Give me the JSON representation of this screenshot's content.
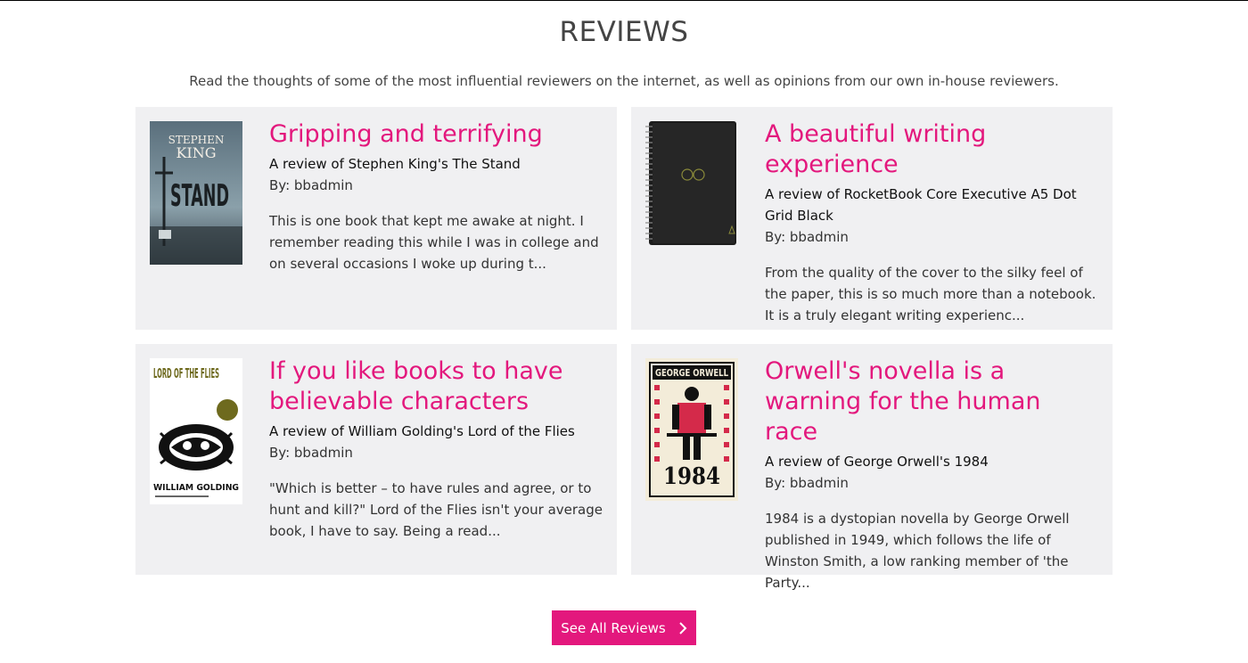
{
  "section": {
    "title": "REVIEWS",
    "subtitle": "Read the thoughts of some of the most influential reviewers on the internet, as well as opinions from our own in-house reviewers."
  },
  "reviews": [
    {
      "title": "Gripping and terrifying",
      "subject": "A review of Stephen King's The Stand",
      "author": "By: bbadmin",
      "excerpt": "This is one book that kept me awake at night. I remember reading this while I was in college and on several occasions I woke up during t...",
      "cover": {
        "top_text": "STEPHEN",
        "middle_text": "KING",
        "main_text": "STAND"
      }
    },
    {
      "title": "A beautiful writing experience",
      "subject": "A review of RocketBook Core Executive A5 Dot Grid Black",
      "author": "By: bbadmin",
      "excerpt": "From the quality of the cover to the silky feel of the paper, this is so much more than a notebook. It is a truly elegant writing experienc..."
    },
    {
      "title": "If you like books to have believable characters",
      "subject": "A review of William Golding's Lord of the Flies",
      "author": "By: bbadmin",
      "excerpt": "\"Which is better – to have rules and agree, or to hunt and kill?\" Lord of the Flies isn't your average book, I have to say. Being a read...",
      "cover": {
        "top_text": "LORD OF THE FLIES",
        "bottom_text": "WILLIAM GOLDING"
      }
    },
    {
      "title": "Orwell's novella is a warning for the human race",
      "subject": "A review of George Orwell's 1984",
      "author": "By: bbadmin",
      "excerpt": "1984 is a dystopian novella by George Orwell published in 1949, which follows the life of Winston Smith, a low ranking member of 'the Party...",
      "cover": {
        "top_text": "GEORGE ORWELL",
        "main_text": "1984"
      }
    }
  ],
  "see_all": {
    "label": "See All Reviews",
    "icon": "chevron-right-icon"
  },
  "colors": {
    "accent": "#e3187d",
    "card_bg": "#f0f0f2"
  }
}
